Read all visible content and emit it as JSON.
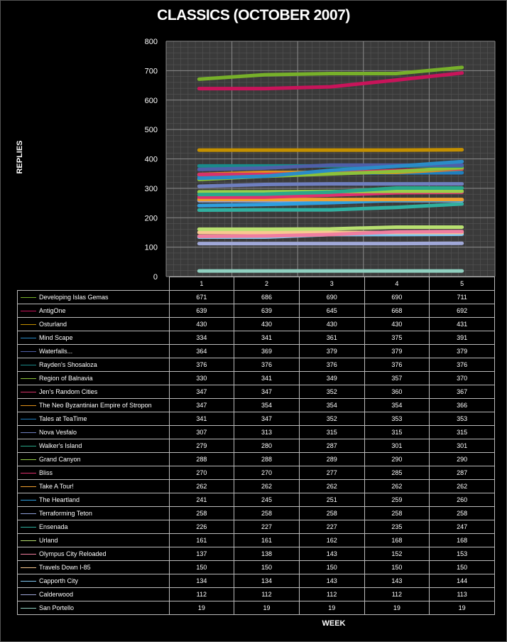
{
  "chart_data": {
    "type": "line",
    "title": "CLASSICS (OCTOBER 2007)",
    "xlabel": "WEEK",
    "ylabel": "REPLIES",
    "ylim": [
      0,
      800
    ],
    "yticks": [
      0,
      100,
      200,
      300,
      400,
      500,
      600,
      700,
      800
    ],
    "categories": [
      "1",
      "2",
      "3",
      "4",
      "5"
    ],
    "grid": true,
    "legend": "data table below chart",
    "series": [
      {
        "name": "Developing Islas Gemas",
        "color": "#77b02a",
        "values": [
          671,
          686,
          690,
          690,
          711
        ]
      },
      {
        "name": "AntigOne",
        "color": "#c8145a",
        "values": [
          639,
          639,
          645,
          668,
          692
        ]
      },
      {
        "name": "Osturland",
        "color": "#c49000",
        "values": [
          430,
          430,
          430,
          430,
          431
        ]
      },
      {
        "name": "Mind Scape",
        "color": "#2a8cc8",
        "values": [
          334,
          341,
          361,
          375,
          391
        ]
      },
      {
        "name": "Waterfalls...",
        "color": "#4f5fa8",
        "values": [
          364,
          369,
          379,
          379,
          379
        ]
      },
      {
        "name": "Rayden's Shosaloza",
        "color": "#1a8a8a",
        "values": [
          376,
          376,
          376,
          376,
          376
        ]
      },
      {
        "name": "Region of Balnavia",
        "color": "#8cc23a",
        "values": [
          330,
          341,
          349,
          357,
          370
        ]
      },
      {
        "name": "Jen's Random Cities",
        "color": "#d6336a",
        "values": [
          347,
          347,
          352,
          360,
          367
        ]
      },
      {
        "name": "The Neo Byzantinian Empire of Stropon",
        "color": "#e0901a",
        "values": [
          347,
          354,
          354,
          354,
          366
        ]
      },
      {
        "name": "Tales at TeaTime",
        "color": "#1f7fbf",
        "values": [
          341,
          347,
          352,
          353,
          353
        ]
      },
      {
        "name": "Nova Vesfalo",
        "color": "#6f7fbf",
        "values": [
          307,
          313,
          315,
          315,
          315
        ]
      },
      {
        "name": "Walker's Island",
        "color": "#2aa88a",
        "values": [
          279,
          280,
          287,
          301,
          301
        ]
      },
      {
        "name": "Grand Canyon",
        "color": "#9ad04a",
        "values": [
          288,
          288,
          289,
          290,
          290
        ]
      },
      {
        "name": "Bliss",
        "color": "#e0306e",
        "values": [
          270,
          270,
          277,
          285,
          287
        ]
      },
      {
        "name": "Take A Tour!",
        "color": "#f0a030",
        "values": [
          262,
          262,
          262,
          262,
          262
        ]
      },
      {
        "name": "The Heartland",
        "color": "#2f9fdf",
        "values": [
          241,
          245,
          251,
          259,
          260
        ]
      },
      {
        "name": "Terraforming Teton",
        "color": "#8fa0d8",
        "values": [
          258,
          258,
          258,
          258,
          258
        ]
      },
      {
        "name": "Ensenada",
        "color": "#30b0a0",
        "values": [
          226,
          227,
          227,
          235,
          247
        ]
      },
      {
        "name": "Urland",
        "color": "#b8e070",
        "values": [
          161,
          161,
          162,
          168,
          168
        ]
      },
      {
        "name": "Olympus City Reloaded",
        "color": "#f07ea0",
        "values": [
          137,
          138,
          143,
          152,
          153
        ]
      },
      {
        "name": "Travels Down I-85",
        "color": "#f8c890",
        "values": [
          150,
          150,
          150,
          150,
          150
        ]
      },
      {
        "name": "Capporth City",
        "color": "#80c8f0",
        "values": [
          134,
          134,
          143,
          143,
          144
        ]
      },
      {
        "name": "Calderwood",
        "color": "#a0a8d8",
        "values": [
          112,
          112,
          112,
          112,
          113
        ]
      },
      {
        "name": "San Portello",
        "color": "#90d0c0",
        "values": [
          19,
          19,
          19,
          19,
          19
        ]
      }
    ]
  }
}
